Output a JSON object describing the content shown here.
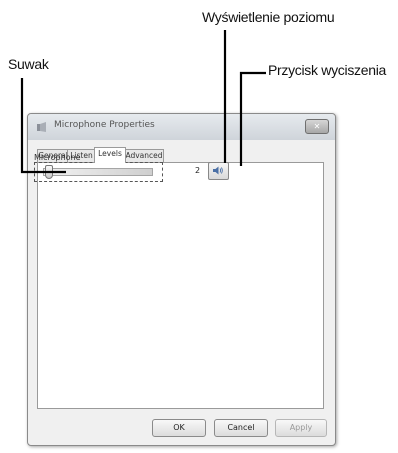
{
  "callouts": {
    "level_display": "Wyświetlenie poziomu",
    "slider": "Suwak",
    "mute_button": "Przycisk wyciszenia"
  },
  "dialog": {
    "title": "Microphone Properties",
    "close_label": "✕",
    "tabs": [
      {
        "label": "General",
        "active": false
      },
      {
        "label": "Listen",
        "active": false
      },
      {
        "label": "Levels",
        "active": true
      },
      {
        "label": "Advanced",
        "active": false
      }
    ],
    "levels": {
      "group_label": "Microphone",
      "slider_level": 0.05,
      "level_value": "2"
    },
    "buttons": {
      "ok": "OK",
      "cancel": "Cancel",
      "apply": "Apply"
    }
  },
  "icons": {
    "app": "microphone-icon",
    "mute": "speaker-icon"
  }
}
